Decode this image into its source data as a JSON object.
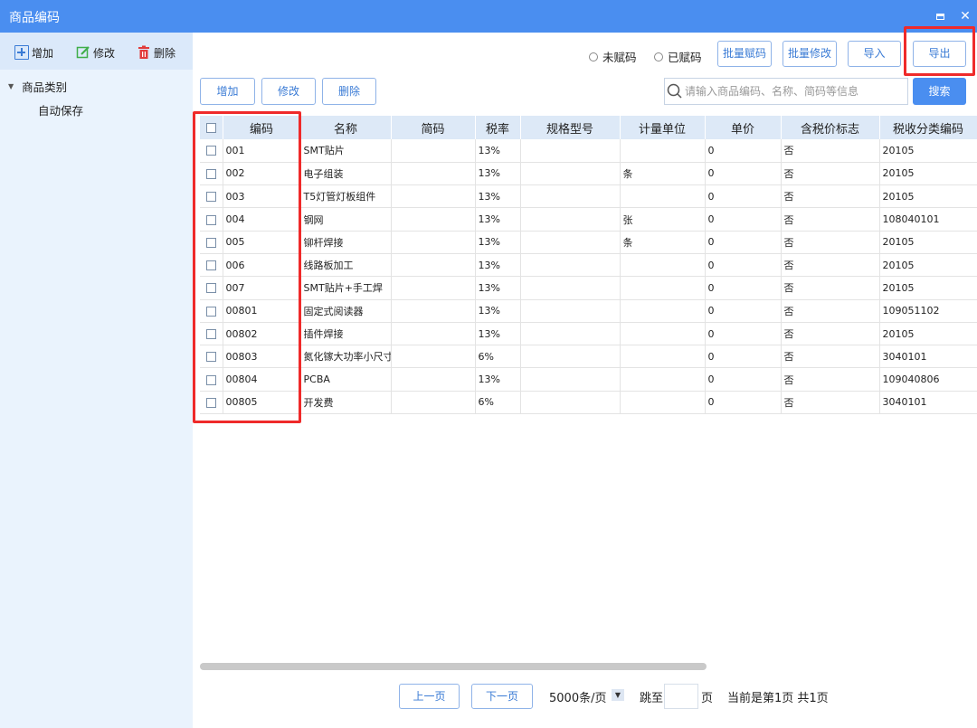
{
  "window": {
    "title": "商品编码"
  },
  "sidebar": {
    "toolbar": {
      "add": "增加",
      "edit": "修改",
      "delete": "删除"
    },
    "tree": {
      "root": "商品类别",
      "child": "自动保存"
    }
  },
  "toolbar": {
    "radio_unassigned": "未赋码",
    "radio_assigned": "已赋码",
    "batch_assign": "批量赋码",
    "batch_edit": "批量修改",
    "import": "导入",
    "export": "导出",
    "add": "增加",
    "edit": "修改",
    "delete": "删除",
    "search_placeholder": "请输入商品编码、名称、简码等信息",
    "search": "搜索"
  },
  "table": {
    "columns": [
      "编码",
      "名称",
      "简码",
      "税率",
      "规格型号",
      "计量单位",
      "单价",
      "含税价标志",
      "税收分类编码"
    ],
    "rows": [
      [
        "001",
        "SMT贴片",
        "",
        "13%",
        "",
        "",
        "0",
        "否",
        "20105"
      ],
      [
        "002",
        "电子组装",
        "",
        "13%",
        "",
        "条",
        "0",
        "否",
        "20105"
      ],
      [
        "003",
        "T5灯管灯板组件",
        "",
        "13%",
        "",
        "",
        "0",
        "否",
        "20105"
      ],
      [
        "004",
        "钢网",
        "",
        "13%",
        "",
        "张",
        "0",
        "否",
        "108040101"
      ],
      [
        "005",
        "铆杆焊接",
        "",
        "13%",
        "",
        "条",
        "0",
        "否",
        "20105"
      ],
      [
        "006",
        "线路板加工",
        "",
        "13%",
        "",
        "",
        "0",
        "否",
        "20105"
      ],
      [
        "007",
        "SMT贴片+手工焊",
        "",
        "13%",
        "",
        "",
        "0",
        "否",
        "20105"
      ],
      [
        "00801",
        "固定式阅读器",
        "",
        "13%",
        "",
        "",
        "0",
        "否",
        "109051102"
      ],
      [
        "00802",
        "插件焊接",
        "",
        "13%",
        "",
        "",
        "0",
        "否",
        "20105"
      ],
      [
        "00803",
        "氮化镓大功率小尺寸",
        "",
        "6%",
        "",
        "",
        "0",
        "否",
        "3040101"
      ],
      [
        "00804",
        "PCBA",
        "",
        "13%",
        "",
        "",
        "0",
        "否",
        "109040806"
      ],
      [
        "00805",
        "开发费",
        "",
        "6%",
        "",
        "",
        "0",
        "否",
        "3040101"
      ]
    ]
  },
  "pager": {
    "prev": "上一页",
    "next": "下一页",
    "page_size": "5000条/页",
    "jump_to": "跳至",
    "page_unit": "页",
    "jump_value": "",
    "status": "当前是第1页 共1页"
  },
  "colors": {
    "accent": "#4a8ef0",
    "highlight": "#ef2a2a",
    "sidebar": "#eaf3fd"
  }
}
